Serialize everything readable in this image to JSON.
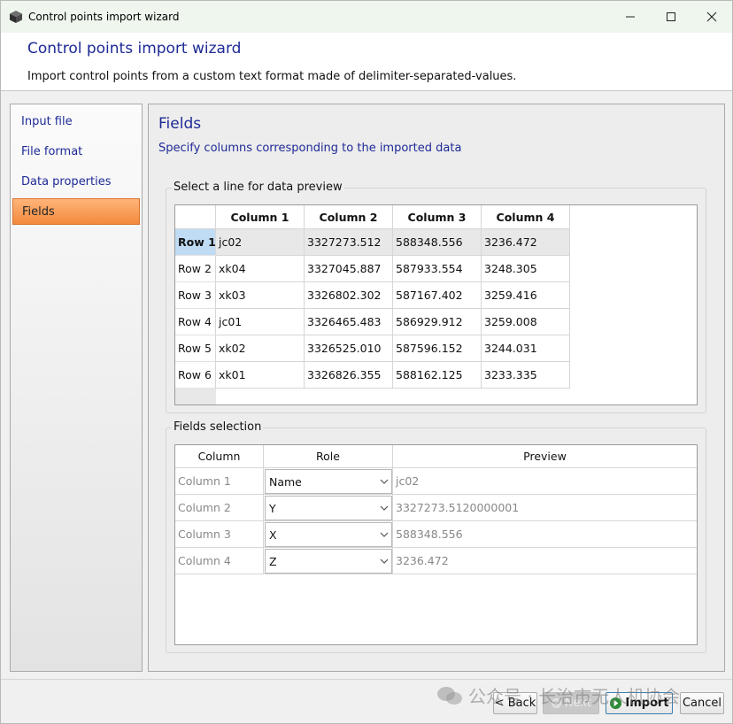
{
  "window": {
    "title": "Control points import wizard"
  },
  "header": {
    "title": "Control points import wizard",
    "description": "Import control points from a custom text format made of delimiter-separated-values."
  },
  "nav": {
    "items": [
      {
        "label": "Input file"
      },
      {
        "label": "File format"
      },
      {
        "label": "Data properties"
      },
      {
        "label": "Fields",
        "active": true
      }
    ]
  },
  "content": {
    "title": "Fields",
    "subtitle": "Specify columns corresponding to the imported data"
  },
  "preview_group": {
    "label": "Select a line for data preview",
    "columns": [
      "Column 1",
      "Column 2",
      "Column 3",
      "Column 4"
    ],
    "rows": [
      {
        "header": "Row 1",
        "cells": [
          "jc02",
          "3327273.512",
          "588348.556",
          "3236.472"
        ],
        "selected": true
      },
      {
        "header": "Row 2",
        "cells": [
          "xk04",
          "3327045.887",
          "587933.554",
          "3248.305"
        ]
      },
      {
        "header": "Row 3",
        "cells": [
          "xk03",
          "3326802.302",
          "587167.402",
          "3259.416"
        ]
      },
      {
        "header": "Row 4",
        "cells": [
          "jc01",
          "3326465.483",
          "586929.912",
          "3259.008"
        ]
      },
      {
        "header": "Row 5",
        "cells": [
          "xk02",
          "3326525.010",
          "587596.152",
          "3244.031"
        ]
      },
      {
        "header": "Row 6",
        "cells": [
          "xk01",
          "3326826.355",
          "588162.125",
          "3233.335"
        ]
      }
    ]
  },
  "fields_group": {
    "label": "Fields selection",
    "headers": {
      "column": "Column",
      "role": "Role",
      "preview": "Preview"
    },
    "rows": [
      {
        "column": "Column 1",
        "role": "Name",
        "preview": "jc02"
      },
      {
        "column": "Column 2",
        "role": "Y",
        "preview": "3327273.5120000001"
      },
      {
        "column": "Column 3",
        "role": "X",
        "preview": "588348.556"
      },
      {
        "column": "Column 4",
        "role": "Z",
        "preview": "3236.472"
      }
    ]
  },
  "footer": {
    "back_label": "< Back",
    "next_label": "Next",
    "import_label": "Import",
    "cancel_label": "Cancel"
  },
  "watermark": {
    "text": "公众号 · 长治市无人机协会"
  },
  "colors": {
    "accent_title": "#1e2a96",
    "active_nav": "#f28a3c",
    "selected_row_header": "#bfdcf4",
    "import_icon": "#2e8b3a"
  }
}
